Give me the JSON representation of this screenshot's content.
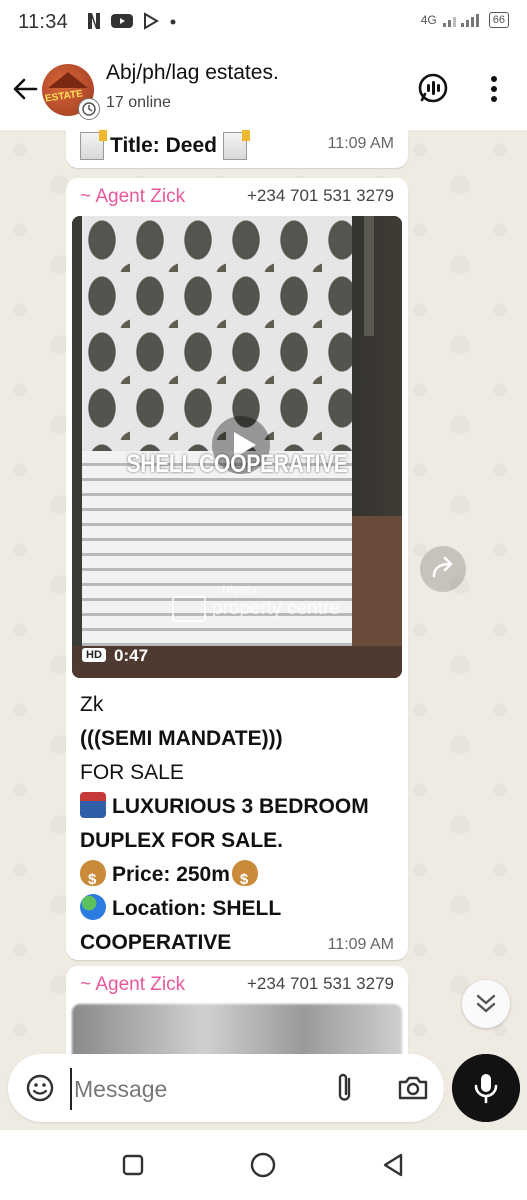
{
  "status_bar": {
    "time": "11:34",
    "network": "4G",
    "battery": "66"
  },
  "header": {
    "title": "Abj/ph/lag estates.",
    "subtitle": "17 online",
    "avatar_text": "ESTATE"
  },
  "previous_message": {
    "text": "Title: Deed",
    "time": "11:09 AM"
  },
  "message": {
    "sender": "~ Agent Zick",
    "phone": "+234 701 531 3279",
    "video": {
      "overlay_text": "SHELL COOPERATIVE",
      "watermark_top": "Nigeria",
      "watermark": "property centre",
      "quality": "HD",
      "duration": "0:47"
    },
    "caption": {
      "line1": "Zk",
      "line2": "(((SEMI MANDATE)))",
      "line3": "FOR SALE",
      "line4": "LUXURIOUS 3 BEDROOM DUPLEX FOR SALE.",
      "line5": "Price: 250m",
      "line6": "Location: SHELL COOPERATIVE"
    },
    "time": "11:09 AM"
  },
  "next_message": {
    "sender": "~ Agent Zick",
    "phone": "+234 701 531 3279"
  },
  "composer": {
    "placeholder": "Message"
  },
  "icons": [
    "back-arrow-icon",
    "meta-ai-icon",
    "more-vert-icon",
    "play-icon",
    "forward-icon",
    "double-chevron-down-icon",
    "sticker-icon",
    "attach-icon",
    "camera-icon",
    "mic-icon",
    "nav-recents-icon",
    "nav-home-icon",
    "nav-back-icon"
  ],
  "colors": {
    "sender": "#e8579c",
    "chat_bg": "#f0ebe2",
    "mic_button": "#121212"
  }
}
